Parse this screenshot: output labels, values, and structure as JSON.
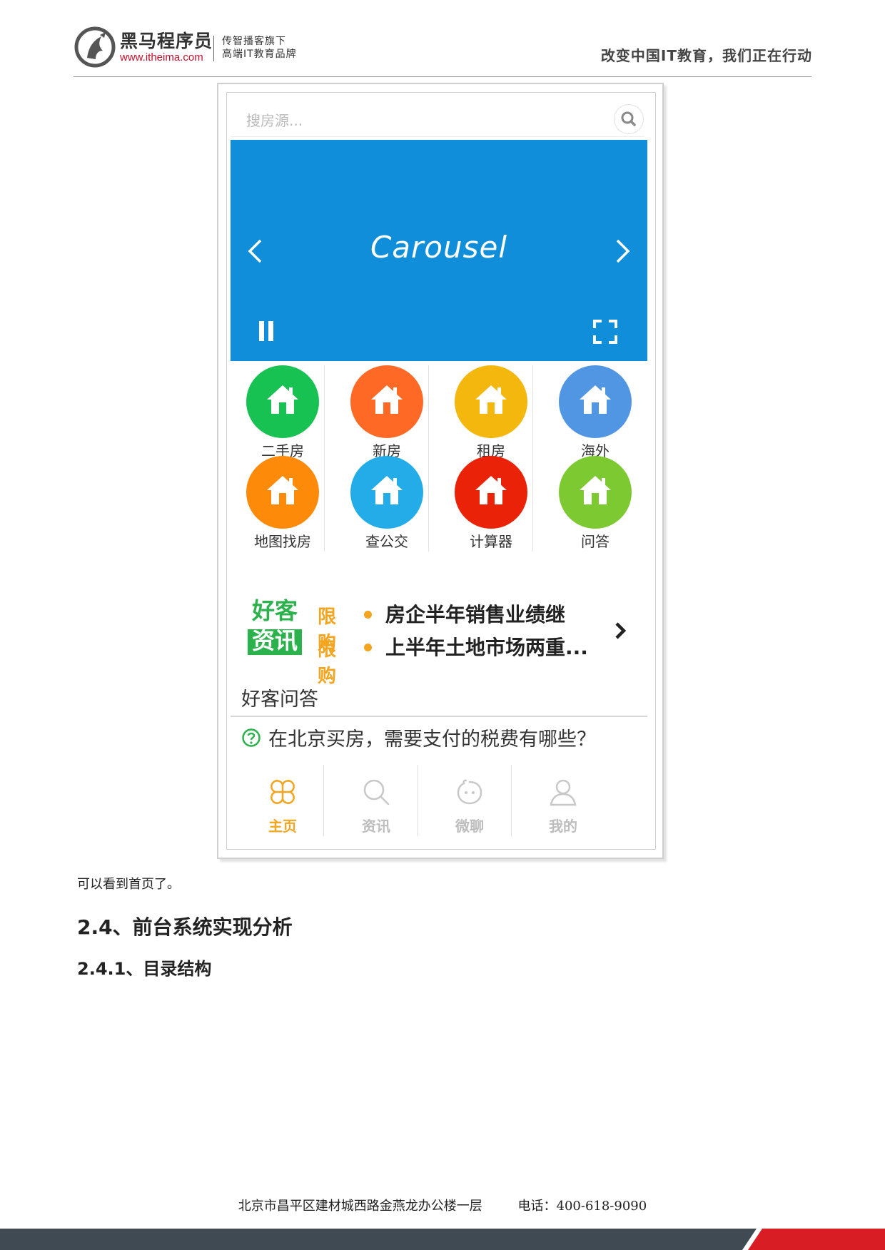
{
  "header": {
    "brand_name": "黑马程序员",
    "brand_url": "www.itheima.com",
    "slogan_line1": "传智播客旗下",
    "slogan_line2": "高端IT教育品牌",
    "motto": "改变中国IT教育，我们正在行动"
  },
  "app": {
    "search": {
      "placeholder": "搜房源..."
    },
    "carousel": {
      "title": "Carousel"
    },
    "categories": [
      {
        "label": "二手房",
        "color": "#17c152"
      },
      {
        "label": "新房",
        "color": "#fe6a25"
      },
      {
        "label": "租房",
        "color": "#f4b70d"
      },
      {
        "label": "海外",
        "color": "#5196e3"
      },
      {
        "label": "地图找房",
        "color": "#fe8a0a"
      },
      {
        "label": "查公交",
        "color": "#24ace8"
      },
      {
        "label": "计算器",
        "color": "#ea2207"
      },
      {
        "label": "问答",
        "color": "#7dc932"
      }
    ],
    "news": {
      "logo_line1": "好客",
      "logo_line2": "资讯",
      "items": [
        {
          "tag": "限购",
          "text": "房企半年销售业绩继"
        },
        {
          "tag": "限购",
          "text": "上半年土地市场两重..."
        }
      ]
    },
    "qa": {
      "title": "好客问答",
      "question": "在北京买房，需要支付的税费有哪些？"
    },
    "tabs": [
      {
        "label": "主页",
        "icon": "home-clover-icon",
        "active": true
      },
      {
        "label": "资讯",
        "icon": "search-icon",
        "active": false
      },
      {
        "label": "微聊",
        "icon": "chat-face-icon",
        "active": false
      },
      {
        "label": "我的",
        "icon": "user-icon",
        "active": false
      }
    ],
    "colors": {
      "accent": "#f3a51f",
      "carousel": "#108ed9",
      "green": "#2bb24c"
    }
  },
  "doc": {
    "caption": "可以看到首页了。",
    "h2": "2.4、前台系统实现分析",
    "h3": "2.4.1、目录结构"
  },
  "footer": {
    "address": "北京市昌平区建材城西路金燕龙办公楼一层",
    "phone": "电话：400-618-9090"
  }
}
